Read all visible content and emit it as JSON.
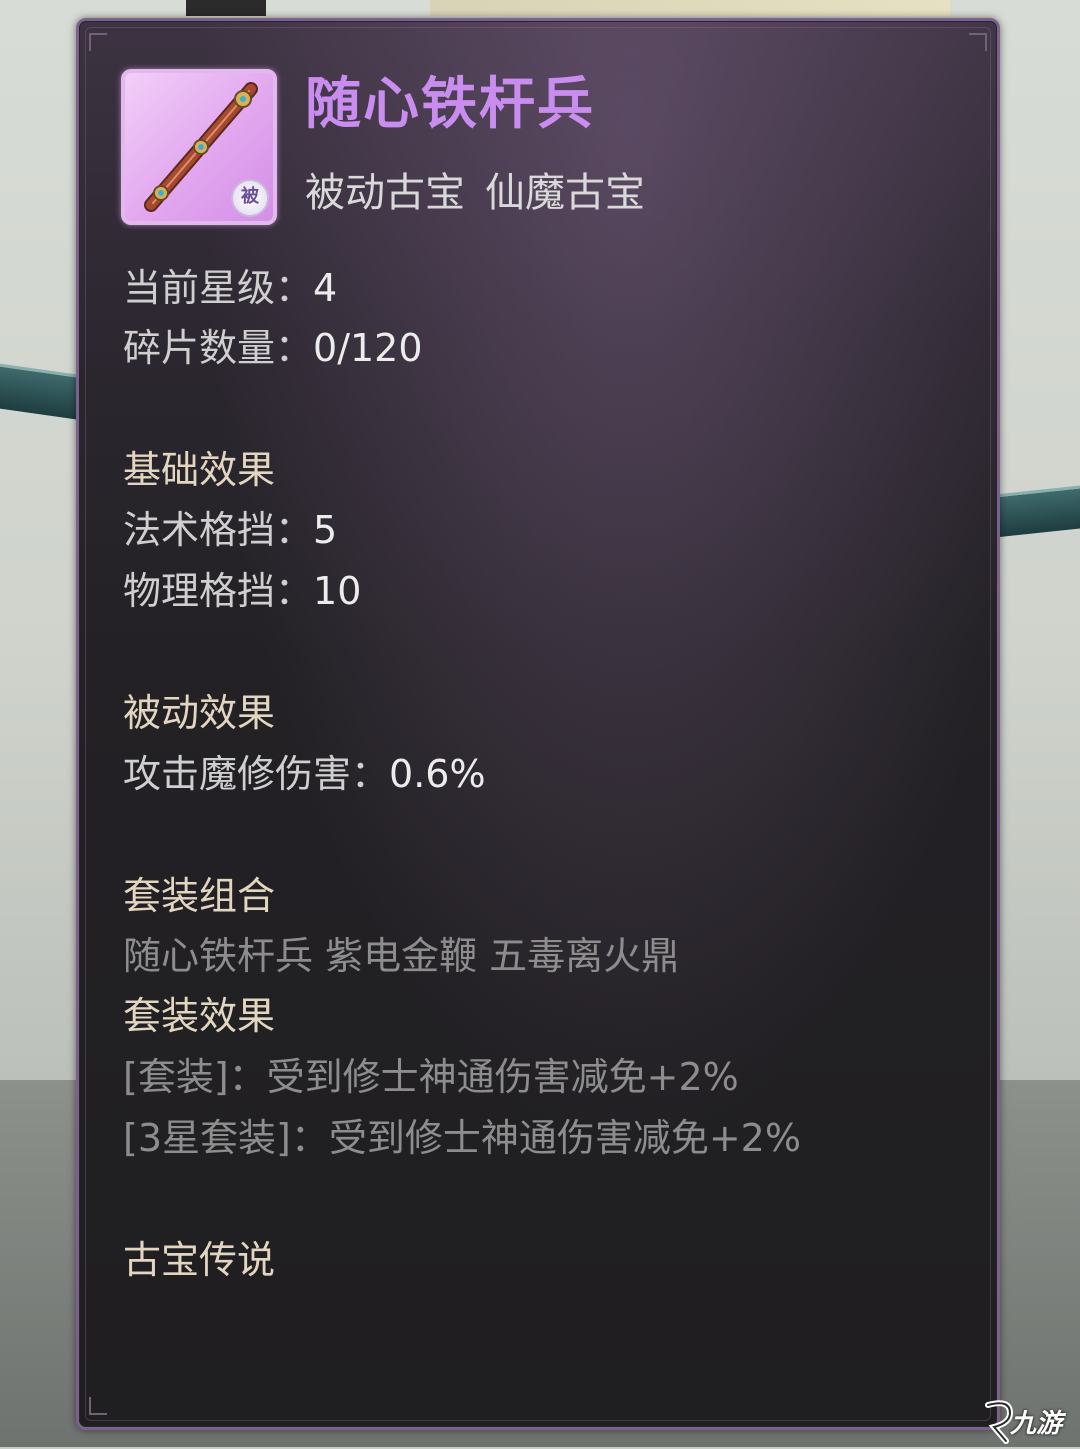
{
  "item": {
    "name": "随心铁杆兵",
    "tags": [
      "被动古宝",
      "仙魔古宝"
    ],
    "badge": "被",
    "icon": "iron-staff-icon",
    "rarity_color": "#c98df0"
  },
  "stats": {
    "star_label": "当前星级：",
    "star_value": "4",
    "shards_label": "碎片数量：",
    "shards_value": "0/120"
  },
  "base_effect": {
    "heading": "基础效果",
    "rows": [
      {
        "label": "法术格挡：",
        "value": "5"
      },
      {
        "label": "物理格挡：",
        "value": "10"
      }
    ]
  },
  "passive_effect": {
    "heading": "被动效果",
    "rows": [
      {
        "label": "攻击魔修伤害：",
        "value": "0.6%"
      }
    ]
  },
  "set_combo": {
    "heading": "套装组合",
    "members": "随心铁杆兵 紫电金鞭 五毒离火鼎"
  },
  "set_effect": {
    "heading": "套装效果",
    "lines": [
      "[套装]：受到修士神通伤害减免+2%",
      "[3星套装]：受到修士神通伤害减免+2%"
    ]
  },
  "lore": {
    "heading": "古宝传说"
  },
  "watermark": {
    "text": "九游"
  }
}
